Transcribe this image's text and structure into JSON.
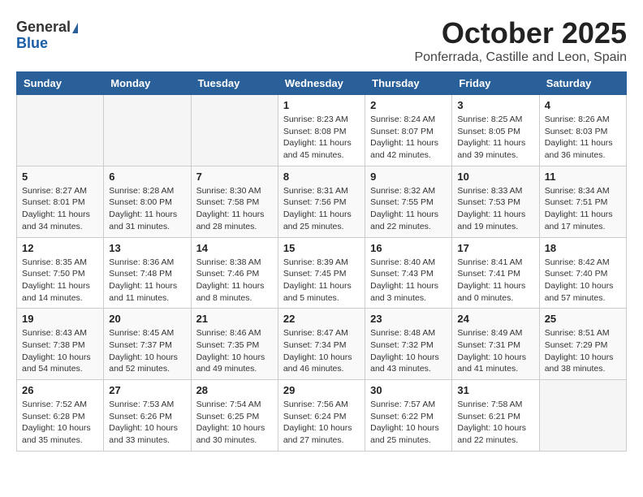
{
  "logo": {
    "general": "General",
    "blue": "Blue"
  },
  "header": {
    "title": "October 2025",
    "subtitle": "Ponferrada, Castille and Leon, Spain"
  },
  "weekdays": [
    "Sunday",
    "Monday",
    "Tuesday",
    "Wednesday",
    "Thursday",
    "Friday",
    "Saturday"
  ],
  "weeks": [
    [
      {
        "day": "",
        "info": ""
      },
      {
        "day": "",
        "info": ""
      },
      {
        "day": "",
        "info": ""
      },
      {
        "day": "1",
        "info": "Sunrise: 8:23 AM\nSunset: 8:08 PM\nDaylight: 11 hours\nand 45 minutes."
      },
      {
        "day": "2",
        "info": "Sunrise: 8:24 AM\nSunset: 8:07 PM\nDaylight: 11 hours\nand 42 minutes."
      },
      {
        "day": "3",
        "info": "Sunrise: 8:25 AM\nSunset: 8:05 PM\nDaylight: 11 hours\nand 39 minutes."
      },
      {
        "day": "4",
        "info": "Sunrise: 8:26 AM\nSunset: 8:03 PM\nDaylight: 11 hours\nand 36 minutes."
      }
    ],
    [
      {
        "day": "5",
        "info": "Sunrise: 8:27 AM\nSunset: 8:01 PM\nDaylight: 11 hours\nand 34 minutes."
      },
      {
        "day": "6",
        "info": "Sunrise: 8:28 AM\nSunset: 8:00 PM\nDaylight: 11 hours\nand 31 minutes."
      },
      {
        "day": "7",
        "info": "Sunrise: 8:30 AM\nSunset: 7:58 PM\nDaylight: 11 hours\nand 28 minutes."
      },
      {
        "day": "8",
        "info": "Sunrise: 8:31 AM\nSunset: 7:56 PM\nDaylight: 11 hours\nand 25 minutes."
      },
      {
        "day": "9",
        "info": "Sunrise: 8:32 AM\nSunset: 7:55 PM\nDaylight: 11 hours\nand 22 minutes."
      },
      {
        "day": "10",
        "info": "Sunrise: 8:33 AM\nSunset: 7:53 PM\nDaylight: 11 hours\nand 19 minutes."
      },
      {
        "day": "11",
        "info": "Sunrise: 8:34 AM\nSunset: 7:51 PM\nDaylight: 11 hours\nand 17 minutes."
      }
    ],
    [
      {
        "day": "12",
        "info": "Sunrise: 8:35 AM\nSunset: 7:50 PM\nDaylight: 11 hours\nand 14 minutes."
      },
      {
        "day": "13",
        "info": "Sunrise: 8:36 AM\nSunset: 7:48 PM\nDaylight: 11 hours\nand 11 minutes."
      },
      {
        "day": "14",
        "info": "Sunrise: 8:38 AM\nSunset: 7:46 PM\nDaylight: 11 hours\nand 8 minutes."
      },
      {
        "day": "15",
        "info": "Sunrise: 8:39 AM\nSunset: 7:45 PM\nDaylight: 11 hours\nand 5 minutes."
      },
      {
        "day": "16",
        "info": "Sunrise: 8:40 AM\nSunset: 7:43 PM\nDaylight: 11 hours\nand 3 minutes."
      },
      {
        "day": "17",
        "info": "Sunrise: 8:41 AM\nSunset: 7:41 PM\nDaylight: 11 hours\nand 0 minutes."
      },
      {
        "day": "18",
        "info": "Sunrise: 8:42 AM\nSunset: 7:40 PM\nDaylight: 10 hours\nand 57 minutes."
      }
    ],
    [
      {
        "day": "19",
        "info": "Sunrise: 8:43 AM\nSunset: 7:38 PM\nDaylight: 10 hours\nand 54 minutes."
      },
      {
        "day": "20",
        "info": "Sunrise: 8:45 AM\nSunset: 7:37 PM\nDaylight: 10 hours\nand 52 minutes."
      },
      {
        "day": "21",
        "info": "Sunrise: 8:46 AM\nSunset: 7:35 PM\nDaylight: 10 hours\nand 49 minutes."
      },
      {
        "day": "22",
        "info": "Sunrise: 8:47 AM\nSunset: 7:34 PM\nDaylight: 10 hours\nand 46 minutes."
      },
      {
        "day": "23",
        "info": "Sunrise: 8:48 AM\nSunset: 7:32 PM\nDaylight: 10 hours\nand 43 minutes."
      },
      {
        "day": "24",
        "info": "Sunrise: 8:49 AM\nSunset: 7:31 PM\nDaylight: 10 hours\nand 41 minutes."
      },
      {
        "day": "25",
        "info": "Sunrise: 8:51 AM\nSunset: 7:29 PM\nDaylight: 10 hours\nand 38 minutes."
      }
    ],
    [
      {
        "day": "26",
        "info": "Sunrise: 7:52 AM\nSunset: 6:28 PM\nDaylight: 10 hours\nand 35 minutes."
      },
      {
        "day": "27",
        "info": "Sunrise: 7:53 AM\nSunset: 6:26 PM\nDaylight: 10 hours\nand 33 minutes."
      },
      {
        "day": "28",
        "info": "Sunrise: 7:54 AM\nSunset: 6:25 PM\nDaylight: 10 hours\nand 30 minutes."
      },
      {
        "day": "29",
        "info": "Sunrise: 7:56 AM\nSunset: 6:24 PM\nDaylight: 10 hours\nand 27 minutes."
      },
      {
        "day": "30",
        "info": "Sunrise: 7:57 AM\nSunset: 6:22 PM\nDaylight: 10 hours\nand 25 minutes."
      },
      {
        "day": "31",
        "info": "Sunrise: 7:58 AM\nSunset: 6:21 PM\nDaylight: 10 hours\nand 22 minutes."
      },
      {
        "day": "",
        "info": ""
      }
    ]
  ]
}
